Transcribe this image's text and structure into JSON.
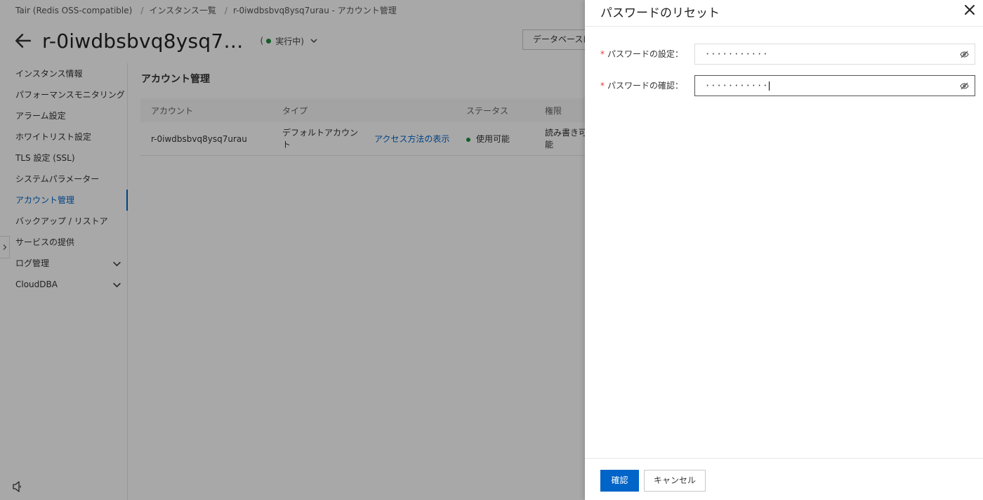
{
  "breadcrumb": {
    "items": [
      "Tair (Redis OSS-compatible)",
      "インスタンス一覧",
      "r-0iwdbsbvq8ysq7urau - アカウント管理"
    ],
    "separator": "/"
  },
  "header": {
    "title": "r-0iwdbsbvq8ysq7…",
    "status_open": "(",
    "status_text": "実行中)",
    "database_button": "データベースに"
  },
  "sidebar": {
    "items": [
      {
        "label": "インスタンス情報"
      },
      {
        "label": "パフォーマンスモニタリング"
      },
      {
        "label": "アラーム設定"
      },
      {
        "label": "ホワイトリスト設定"
      },
      {
        "label": "TLS 設定 (SSL)"
      },
      {
        "label": "システムパラメーター"
      },
      {
        "label": "アカウント管理"
      },
      {
        "label": "バックアップ / リストア"
      },
      {
        "label": "サービスの提供"
      },
      {
        "label": "ログ管理"
      },
      {
        "label": "CloudDBA"
      }
    ]
  },
  "content": {
    "title": "アカウント管理",
    "columns": [
      "アカウント",
      "タイプ",
      "ステータス",
      "権限"
    ],
    "rows": [
      {
        "account": "r-0iwdbsbvq8ysq7urau",
        "type": "デフォルトアカウント",
        "action": "アクセス方法の表示",
        "status": "使用可能",
        "permission": "読み書き可能"
      }
    ]
  },
  "drawer": {
    "title": "パスワードのリセット",
    "required_mark": "*",
    "fields": [
      {
        "label": "パスワードの設定：",
        "value": "···········"
      },
      {
        "label": "パスワードの確認：",
        "value": "···········"
      }
    ],
    "confirm_label": "確認",
    "cancel_label": "キャンセル"
  },
  "colors": {
    "accent": "#0064c8",
    "success": "#1e8e3e",
    "required": "#e23c39"
  },
  "icons": [
    "back-arrow-icon",
    "chevron-down-icon",
    "close-icon",
    "eye-off-icon",
    "chevron-right-icon",
    "speaker-icon"
  ]
}
